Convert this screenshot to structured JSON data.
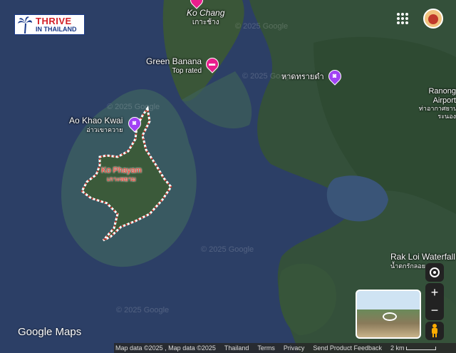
{
  "brand": {
    "line1": "THRIVE",
    "line2": "IN THAILAND"
  },
  "map": {
    "watermark": "© 2025 Google",
    "labels": {
      "ko_chang": {
        "name": "Ko Chang",
        "native": "เกาะช้าง"
      },
      "green_banana": {
        "name": "Green Banana",
        "sub": "Top rated"
      },
      "had_sai_dam": {
        "name": "หาดทรายดำ"
      },
      "ao_khao_kwai": {
        "name": "Ao Khao Kwai",
        "native": "อ่าวเขาควาย"
      },
      "ko_phayam": {
        "name": "Ko Phayam",
        "native": "เกาะพยาม"
      },
      "ranong_airport": {
        "line1": "Ranong",
        "line2": "Airport",
        "native1": "ท่าอากาศยาน",
        "native2": "ระนอง"
      },
      "rak_loi": {
        "name": "Rak Loi Waterfall",
        "native": "น้ำตกรักลอย"
      }
    },
    "google_logo": "Google Maps",
    "colors": {
      "sea": "#2c3f66",
      "land": "#3b5a3a",
      "highlight": "#d93025",
      "pin": "#a142f4"
    }
  },
  "footer": {
    "map_data": "Map data ©2025 , Map data ©2025",
    "country": "Thailand",
    "terms": "Terms",
    "privacy": "Privacy",
    "feedback": "Send Product Feedback",
    "scale": "2 km"
  },
  "controls": {
    "zoom_in": "+",
    "zoom_out": "−"
  }
}
